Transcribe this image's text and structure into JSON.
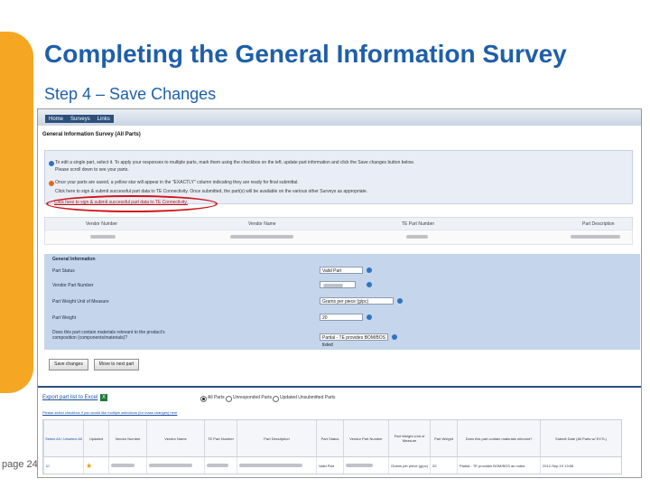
{
  "slide": {
    "title": "Completing the General Information Survey",
    "subtitle": "Step 4 – Save Changes",
    "page_label": "page 24"
  },
  "app": {
    "nav": [
      "Home",
      "Surveys",
      "Links"
    ],
    "title": "General Information Survey (All Parts)",
    "instructions": [
      "To edit a single part, select it. To apply your responses to multiple parts, mark them using the checkbox on the left, update part information and click the Save changes button below.",
      "Please scroll down to see your parts.",
      "Once your parts are saved, a yellow star will appear in the \"EXACTLY\" column indicating they are ready for final submittal.",
      "Click here to sign & submit successful part data to TE Connectivity. Once submitted, the part(s) will be available on the various other Surveys as appropriate."
    ],
    "callout_text": "Click here to sign & submit successful part data to TE Connectivity.",
    "grid_headers": [
      "Vendor Number",
      "Vendor Name",
      "TE Part Number",
      "Part Description"
    ],
    "general_info": {
      "heading": "General Information",
      "fields": [
        {
          "label": "Part Status",
          "value": "Valid Part"
        },
        {
          "label": "Vendor Part Number",
          "value": ""
        },
        {
          "label": "Part Weight Unit of Measure",
          "value": "Grams per piece (g/pc)"
        },
        {
          "label": "Part Weight",
          "value": "20"
        },
        {
          "label": "Does this part contain materials relevant to the product's composition (components/materials)?",
          "value": "Partial - TE provides BOM/BOS listed"
        }
      ]
    },
    "buttons": {
      "save": "Save changes",
      "prior": "Move to next part"
    },
    "export_label": "Export part list to Excel",
    "filter_options": [
      "All Parts",
      "Unresponded Parts",
      "Updated Unsubmitted Parts"
    ],
    "hint": "Please select checkbox if you would like multiple selections (for mass changes) here",
    "table_headers": [
      "Select All / Unselect All",
      "Updated",
      "Vendor Number",
      "Vendor Name",
      "TE Part Number",
      "Part Description",
      "Part Status",
      "Vendor Part Number",
      "Part Weight Unit of Measure",
      "Part Weight",
      "Does this part contain materials relevant?",
      "Submit Date (All Parts w/ EXTL)"
    ],
    "table_row": [
      "",
      "",
      "",
      "",
      "",
      "",
      "Valid Part",
      "",
      "Grams per piece (g/pc)",
      "20",
      "Partial - TE provides BOM/BOS as noted",
      "2012-Sep-19 13:58"
    ],
    "colors": {
      "accent": "#f5a623",
      "title": "#1f5fa8",
      "callout": "#d0151b",
      "panel": "#c5d6ec"
    }
  }
}
